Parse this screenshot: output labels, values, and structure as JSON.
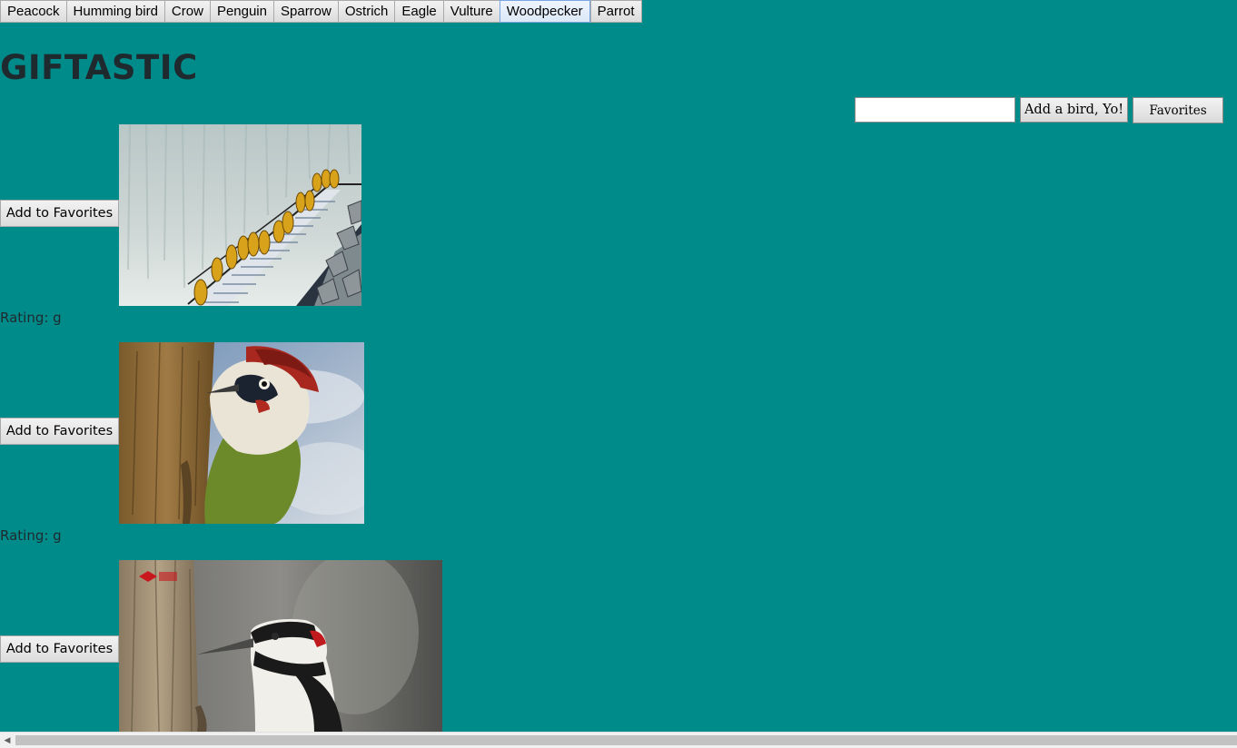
{
  "nav": {
    "birds": [
      "Peacock",
      "Humming bird",
      "Crow",
      "Penguin",
      "Sparrow",
      "Ostrich",
      "Eagle",
      "Vulture",
      "Woodpecker",
      "Parrot"
    ]
  },
  "page": {
    "title": "GIFTASTIC"
  },
  "controls": {
    "input_value": "",
    "add_bird_label": "Add a bird, Yo!",
    "favorites_label": "Favorites"
  },
  "gifs": [
    {
      "button": "Add to Favorites",
      "rating": "Rating: g"
    },
    {
      "button": "Add to Favorites",
      "rating": "Rating: g"
    },
    {
      "button": "Add to Favorites"
    }
  ],
  "colors": {
    "background": "#008b8b"
  }
}
